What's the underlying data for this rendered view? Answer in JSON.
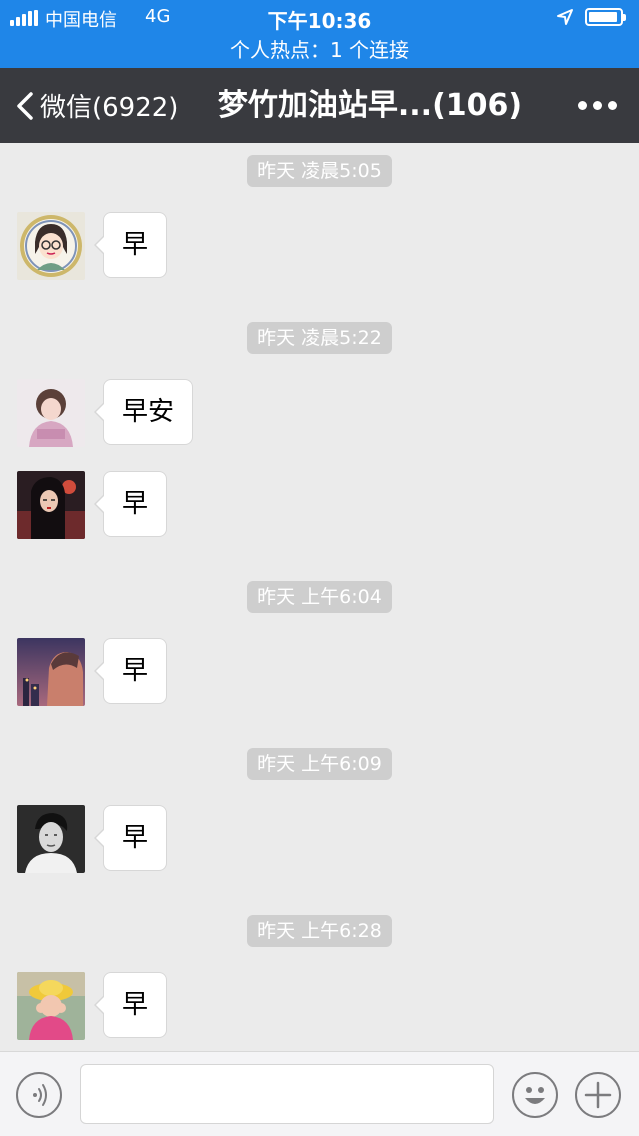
{
  "status_bar": {
    "carrier": "中国电信",
    "network": "4G",
    "time": "下午10:36",
    "hotspot": "个人热点：1 个连接",
    "colors": {
      "bar": "#1f86e8"
    }
  },
  "nav": {
    "back_label": "微信(6922)",
    "title": "梦竹加油站早...(106)",
    "icons": {
      "back": "chevron-left-icon",
      "more": "more-dots-icon"
    }
  },
  "chat": {
    "groups": [
      {
        "timestamp": "昨天 凌晨5:05",
        "messages": [
          {
            "avatar": "cartoon-girl-avatar",
            "text": "早"
          }
        ]
      },
      {
        "timestamp": "昨天 凌晨5:22",
        "messages": [
          {
            "avatar": "child-photo-avatar",
            "text": "早安"
          },
          {
            "avatar": "dark-illustration-avatar",
            "text": "早"
          }
        ]
      },
      {
        "timestamp": "昨天 上午6:04",
        "messages": [
          {
            "avatar": "night-scene-avatar",
            "text": "早"
          }
        ]
      },
      {
        "timestamp": "昨天 上午6:09",
        "messages": [
          {
            "avatar": "man-portrait-avatar",
            "text": "早"
          }
        ]
      },
      {
        "timestamp": "昨天 上午6:28",
        "messages": [
          {
            "avatar": "yellow-hat-child-avatar",
            "text": "早"
          }
        ]
      }
    ]
  },
  "input_bar": {
    "value": "",
    "icons": {
      "voice": "voice-icon",
      "emoji": "emoji-icon",
      "plus": "plus-icon"
    }
  }
}
